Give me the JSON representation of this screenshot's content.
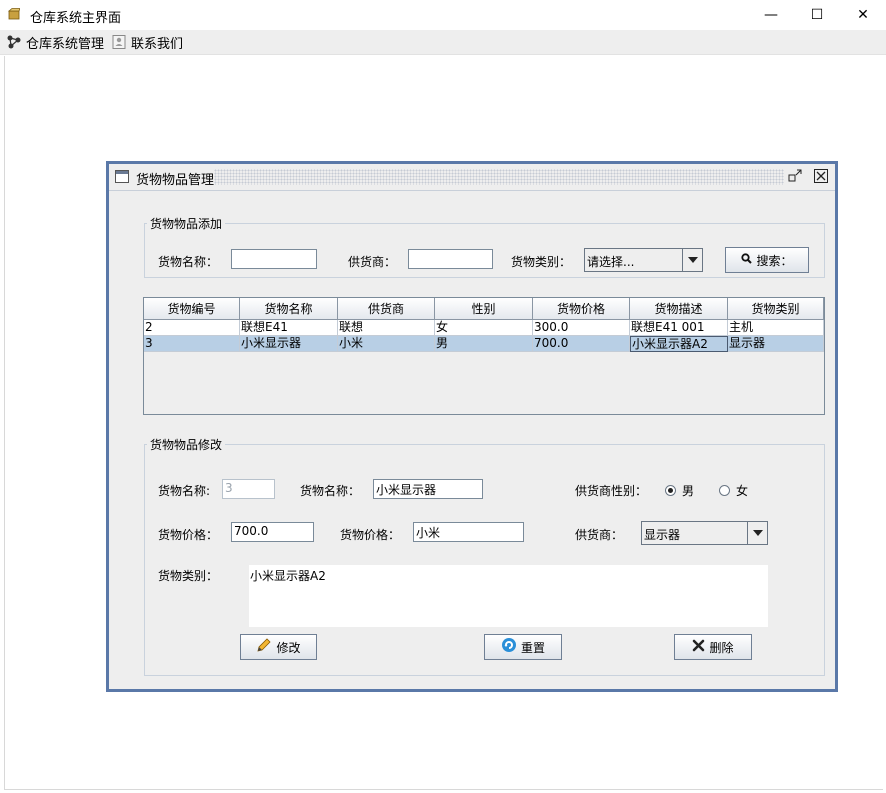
{
  "window": {
    "title": "仓库系统主界面",
    "controls": {
      "minimize": "—",
      "maximize": "☐",
      "close": "✕"
    }
  },
  "menubar": {
    "items": [
      {
        "label": "仓库系统管理",
        "icon": "network-icon"
      },
      {
        "label": "联系我们",
        "icon": "contact-icon"
      }
    ]
  },
  "internal_frame": {
    "title": "货物物品管理",
    "add_section": {
      "legend": "货物物品添加",
      "name_label": "货物名称：",
      "name_value": "",
      "supplier_label": "供货商：",
      "supplier_value": "",
      "category_label": "货物类别：",
      "category_selected": "请选择...",
      "search_button": "搜索："
    },
    "table": {
      "columns": [
        "货物编号",
        "货物名称",
        "供货商",
        "性别",
        "货物价格",
        "货物描述",
        "货物类别"
      ],
      "rows": [
        {
          "cells": [
            "2",
            "联想E41",
            "联想",
            "女",
            "300.0",
            "联想E41 001",
            "主机"
          ],
          "selected": false
        },
        {
          "cells": [
            "3",
            "小米显示器",
            "小米",
            "男",
            "700.0",
            "小米显示器A2",
            "显示器"
          ],
          "selected": true
        }
      ]
    },
    "edit_section": {
      "legend": "货物物品修改",
      "id_label": "货物名称:",
      "id_value": "3",
      "name_label": "货物名称：",
      "name_value": "小米显示器",
      "gender_label": "供货商性别：",
      "gender_options": [
        "男",
        "女"
      ],
      "gender_selected": "男",
      "price_label": "货物价格：",
      "price_value": "700.0",
      "price2_label": "货物价格：",
      "price2_value": "小米",
      "supplier_label": "供货商：",
      "supplier_selected": "显示器",
      "category_label": "货物类别：",
      "description_value": "小米显示器A2",
      "buttons": {
        "modify": "修改",
        "reset": "重置",
        "delete": "删除"
      }
    }
  },
  "colors": {
    "frame_border": "#5a78a8",
    "selected_row": "#b8cfe5",
    "panel_bg": "#eeeeee"
  }
}
